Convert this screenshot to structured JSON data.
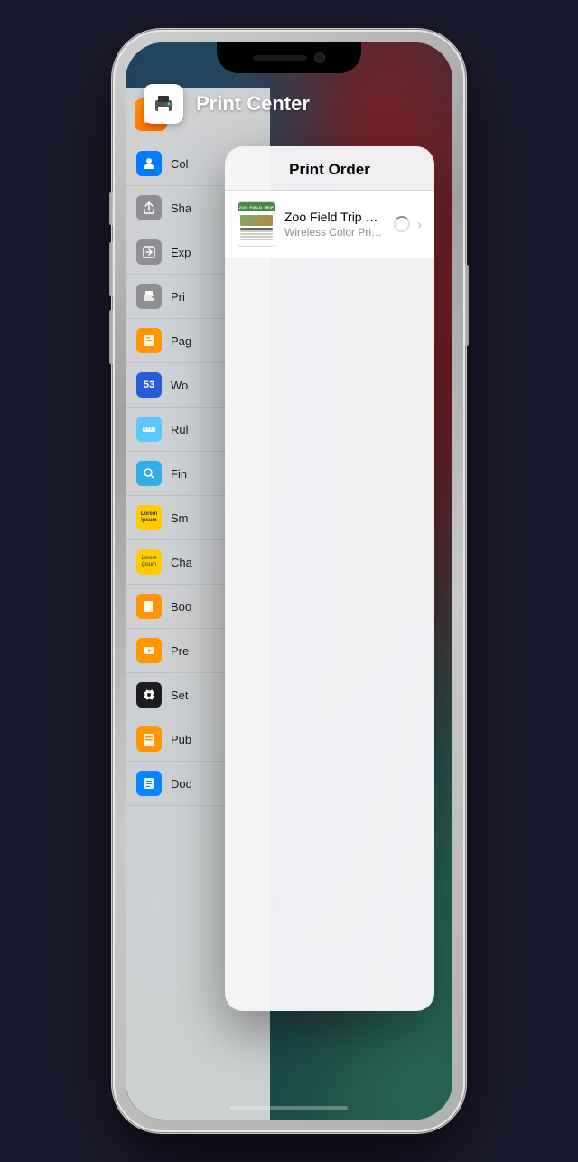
{
  "phone": {
    "header": {
      "title": "Print Center",
      "icon_label": "print-center-icon"
    },
    "modal": {
      "title": "Print Order",
      "job": {
        "title": "Zoo Field Trip Permission Form",
        "subtitle": "Wireless Color Printer –"
      }
    },
    "left_panel": {
      "menu_items": [
        {
          "label": "Col",
          "icon": "person-icon",
          "color": "blue"
        },
        {
          "label": "Sha",
          "icon": "share-icon",
          "color": "gray"
        },
        {
          "label": "Exp",
          "icon": "export-icon",
          "color": "gray"
        },
        {
          "label": "Pri",
          "icon": "print-icon",
          "color": "gray"
        },
        {
          "label": "Pag",
          "icon": "pages-icon",
          "color": "orange"
        },
        {
          "label": "Wo",
          "icon": "word-icon",
          "color": "blue2"
        },
        {
          "label": "Rul",
          "icon": "ruler-icon",
          "color": "teal"
        },
        {
          "label": "Fin",
          "icon": "find-icon",
          "color": "teal"
        },
        {
          "label": "Sm",
          "icon": "lorem-icon",
          "color": "yellow"
        },
        {
          "label": "Cha",
          "icon": "char-icon",
          "color": "yellow"
        },
        {
          "label": "Boo",
          "icon": "book-icon",
          "color": "orange"
        },
        {
          "label": "Pre",
          "icon": "present-icon",
          "color": "orange"
        },
        {
          "label": "Set",
          "icon": "settings-icon",
          "color": "dark"
        },
        {
          "label": "Pub",
          "icon": "pub-icon",
          "color": "red"
        },
        {
          "label": "Doc",
          "icon": "doc-icon",
          "color": "blue2"
        }
      ]
    }
  }
}
